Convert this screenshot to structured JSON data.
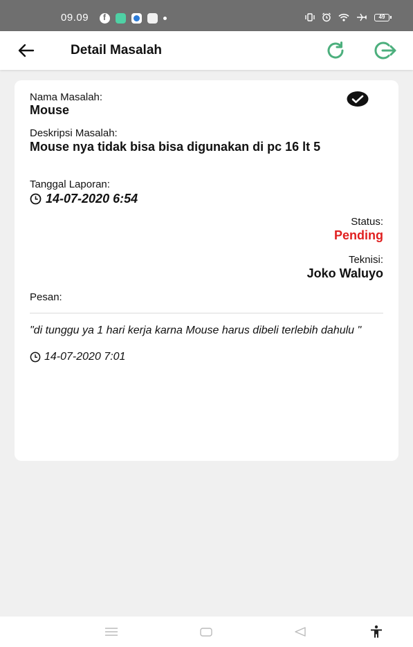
{
  "status_bar": {
    "time": "09.09",
    "battery": "49"
  },
  "app_bar": {
    "title": "Detail Masalah"
  },
  "detail": {
    "name_label": "Nama Masalah:",
    "name_value": "Mouse",
    "desc_label": "Deskripsi Masalah:",
    "desc_value": "Mouse nya tidak bisa bisa digunakan di pc 16 lt 5",
    "date_label": "Tanggal Laporan:",
    "date_value": "14-07-2020 6:54",
    "status_label": "Status:",
    "status_value": "Pending",
    "tech_label": "Teknisi:",
    "tech_value": "Joko Waluyo",
    "message_label": "Pesan:"
  },
  "messages": [
    {
      "text": "\"di tunggu ya 1 hari kerja karna Mouse harus dibeli terlebih dahulu \"",
      "date": "14-07-2020 7:01"
    }
  ],
  "colors": {
    "accent_green": "#4caf7d",
    "status_pending": "#e02020",
    "status_bar": "#6f6f6f"
  },
  "icons": {
    "back": "arrow-left-icon",
    "refresh": "refresh-icon",
    "logout": "logout-icon",
    "resolved": "check-circle-icon",
    "time": "clock-icon"
  }
}
